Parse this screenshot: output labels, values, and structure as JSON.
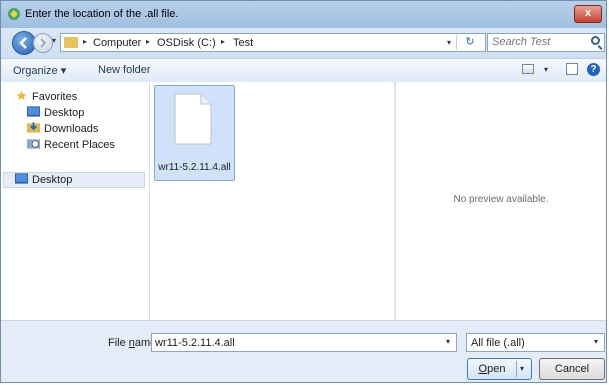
{
  "window": {
    "title": "Enter the location of the .all file.",
    "close_label": "x"
  },
  "address": {
    "crumbs": [
      "Computer",
      "OSDisk (C:)",
      "Test"
    ],
    "separator": "▸",
    "dropdown_glyph": "▾",
    "refresh_glyph": "↻"
  },
  "search": {
    "placeholder": "Search Test"
  },
  "toolbar": {
    "organize_label": "Organize ▾",
    "new_folder_label": "New folder",
    "help_glyph": "?"
  },
  "navigation": {
    "favorites_label": "Favorites",
    "items": [
      {
        "label": "Desktop",
        "icon": "desktop-icon"
      },
      {
        "label": "Downloads",
        "icon": "downloads-icon"
      },
      {
        "label": "Recent Places",
        "icon": "recent-places-icon"
      }
    ],
    "desktop_label": "Desktop"
  },
  "files": [
    {
      "name": "wr11-5.2.11.4.all",
      "selected": true
    }
  ],
  "preview": {
    "message": "No preview available."
  },
  "footer": {
    "file_name_label_prefix": "File ",
    "file_name_label_underlined": "n",
    "file_name_label_suffix": "ame:",
    "file_name_value": "wr11-5.2.11.4.all",
    "file_type_value": "All file (.all)",
    "open_label_underlined": "O",
    "open_label_rest": "pen",
    "cancel_label": "Cancel"
  },
  "colors": {
    "accent": "#1f63c4",
    "selection": "#cfe2f9",
    "titlebar": "#b9d1ea"
  }
}
